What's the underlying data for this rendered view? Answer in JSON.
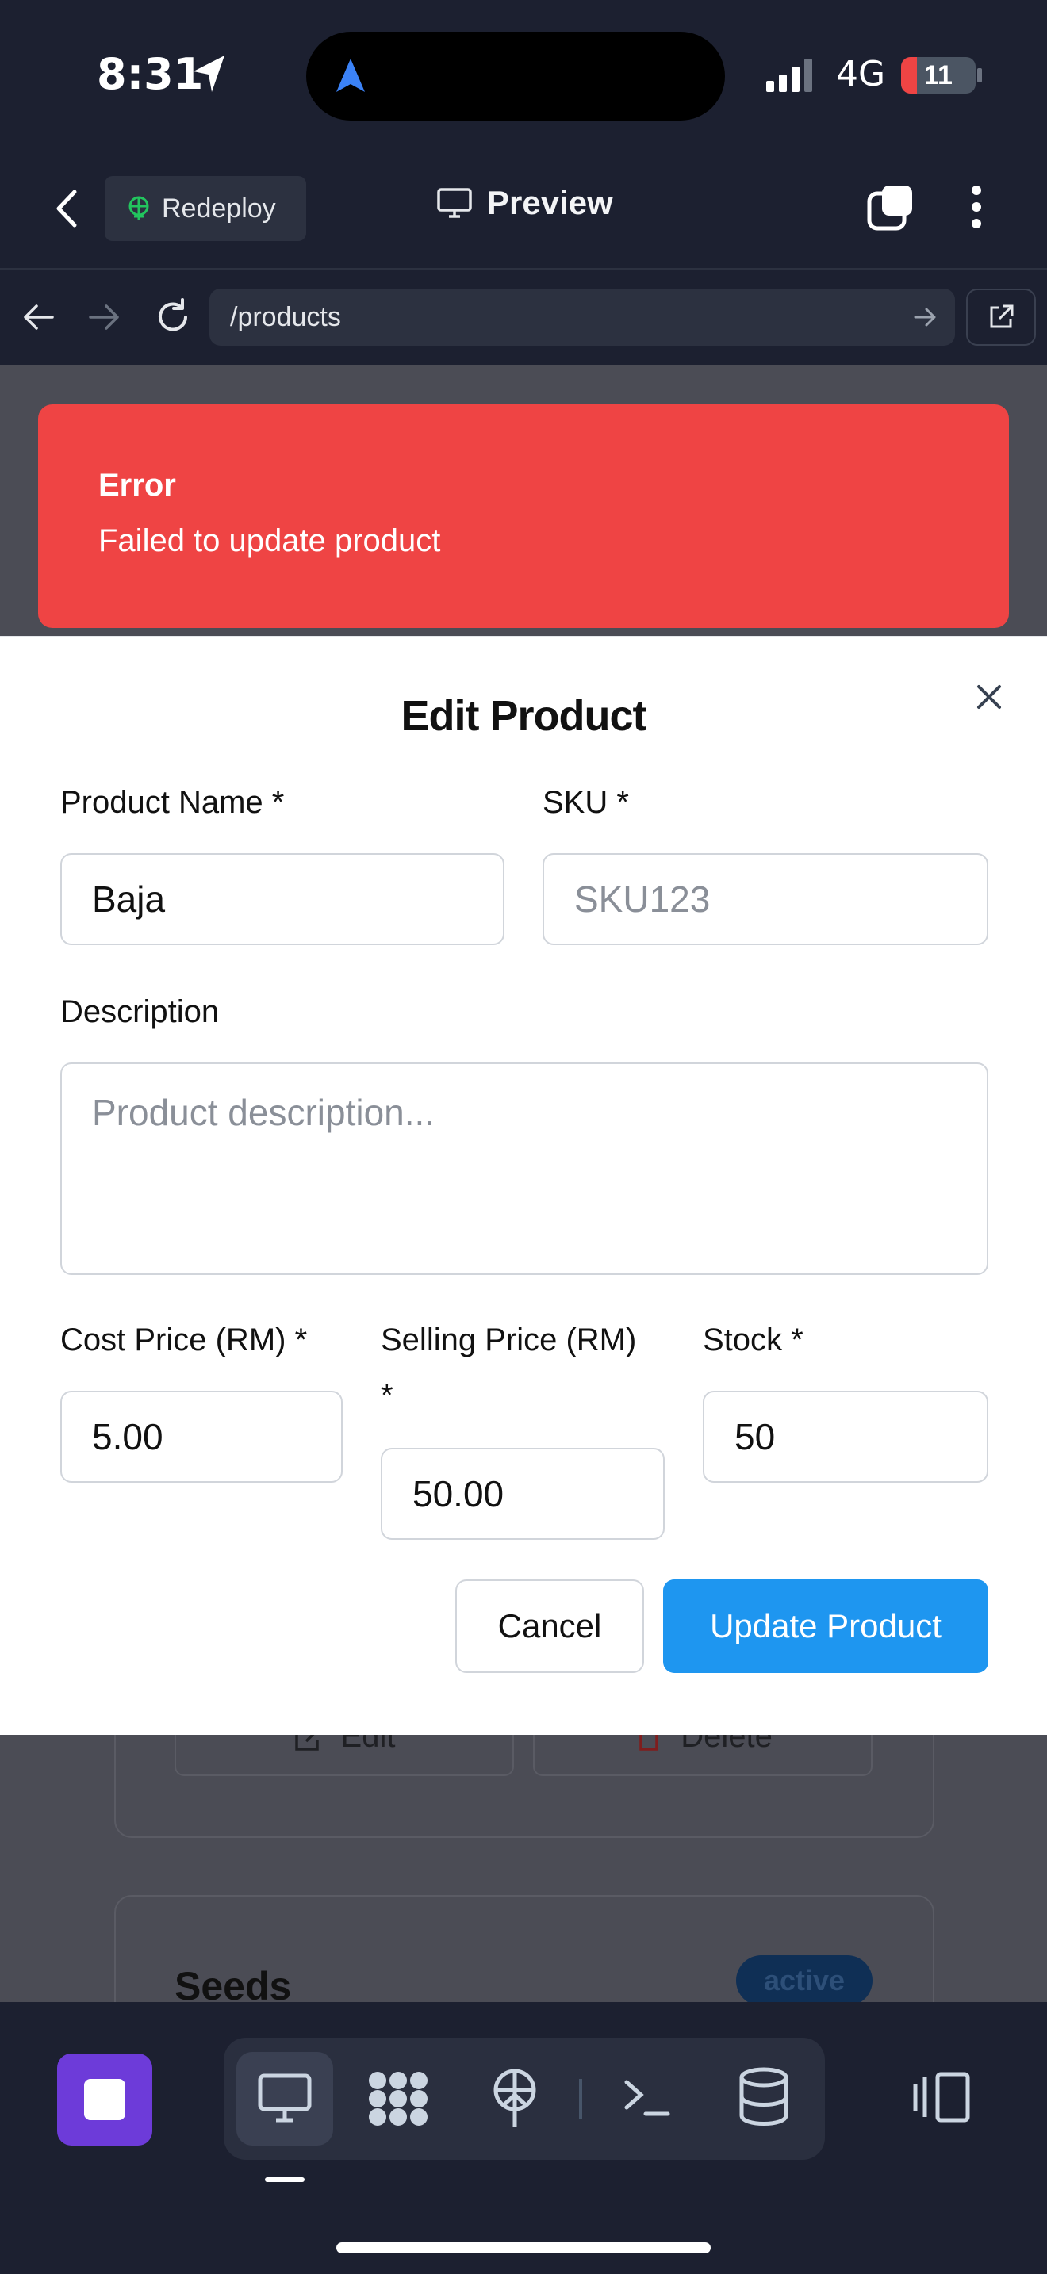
{
  "status_bar": {
    "time": "8:31",
    "network": "4G",
    "battery": "11"
  },
  "app_header": {
    "back_icon": "chevron-left-icon",
    "redeploy_label": "Redeploy",
    "preview_label": "Preview"
  },
  "browser": {
    "url": "/products"
  },
  "background_page": {
    "edit_label": "Edit",
    "delete_label": "Delete",
    "card_title": "Seeds",
    "status_badge": "active"
  },
  "toast": {
    "title": "Error",
    "message": "Failed to update product",
    "color": "#ef4444"
  },
  "modal": {
    "title": "Edit Product",
    "product_name_label": "Product Name *",
    "product_name_value": "Baja",
    "sku_label": "SKU *",
    "sku_placeholder": "SKU123",
    "description_label": "Description",
    "description_placeholder": "Product description...",
    "cost_price_label": "Cost Price (RM) *",
    "cost_price_value": "5.00",
    "selling_price_label_line1": "Selling Price (RM)",
    "selling_price_label_line2": "*",
    "selling_price_value": "50.00",
    "stock_label": "Stock *",
    "stock_value": "50",
    "cancel_label": "Cancel",
    "update_label": "Update Product",
    "accent_color": "#1e96f0"
  },
  "dock": {
    "items": [
      "stop-icon",
      "desktop-icon",
      "grid-icon",
      "deploy-icon",
      "terminal-icon",
      "database-icon",
      "panel-icon"
    ]
  }
}
